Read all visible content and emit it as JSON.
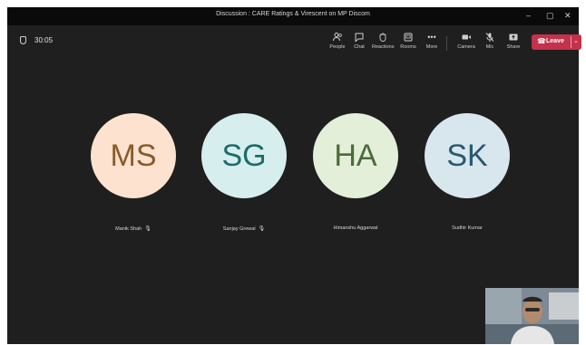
{
  "window": {
    "title": "Discussion : CARE Ratings & Virescent on MP Discom",
    "controls": [
      "–",
      "▢",
      "✕"
    ]
  },
  "toolbar": {
    "timer": "30:05",
    "buttons": [
      {
        "label": "People",
        "icon": "people-icon"
      },
      {
        "label": "Chat",
        "icon": "chat-icon"
      },
      {
        "label": "Reactions",
        "icon": "reactions-icon"
      },
      {
        "label": "Rooms",
        "icon": "rooms-icon"
      },
      {
        "label": "More",
        "icon": "more-icon"
      },
      {
        "label": "Camera",
        "icon": "camera-icon"
      },
      {
        "label": "Mic",
        "icon": "mic-off-icon"
      },
      {
        "label": "Share",
        "icon": "share-icon"
      }
    ],
    "leave_label": "Leave"
  },
  "participants": [
    {
      "initials": "MS",
      "name": "Manik Shah",
      "muted": true,
      "bg": "#fde3cf",
      "fg": "#8a5a2b"
    },
    {
      "initials": "SG",
      "name": "Sanjay Grewal",
      "muted": true,
      "bg": "#d6efee",
      "fg": "#1e6b6b"
    },
    {
      "initials": "HA",
      "name": "Himanshu Aggarwal",
      "muted": false,
      "bg": "#e3efd9",
      "fg": "#4d6b3a"
    },
    {
      "initials": "SK",
      "name": "Sudhir Kumar",
      "muted": false,
      "bg": "#d8e7ee",
      "fg": "#28596e"
    }
  ],
  "colors": {
    "leave": "#c4314b",
    "stage": "#1f1f1f",
    "titlebar": "#0a0a0a"
  }
}
